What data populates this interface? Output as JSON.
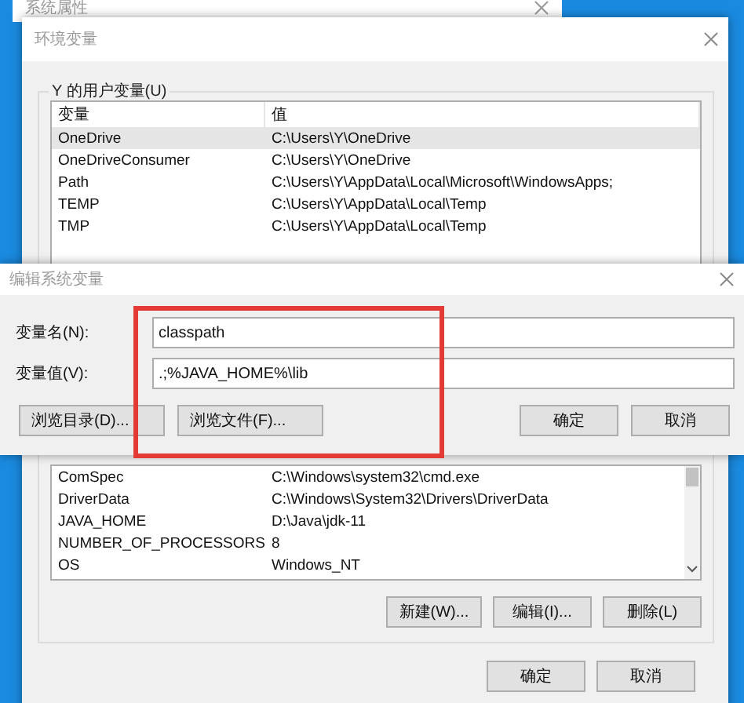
{
  "background_window": {
    "title": "系统属性"
  },
  "env_window": {
    "title": "环境变量",
    "user_vars": {
      "label": "Y 的用户变量(U)",
      "columns": [
        "变量",
        "值"
      ],
      "rows": [
        {
          "name": "OneDrive",
          "value": "C:\\Users\\Y\\OneDrive",
          "selected": true
        },
        {
          "name": "OneDriveConsumer",
          "value": "C:\\Users\\Y\\OneDrive",
          "selected": false
        },
        {
          "name": "Path",
          "value": "C:\\Users\\Y\\AppData\\Local\\Microsoft\\WindowsApps;",
          "selected": false
        },
        {
          "name": "TEMP",
          "value": "C:\\Users\\Y\\AppData\\Local\\Temp",
          "selected": false
        },
        {
          "name": "TMP",
          "value": "C:\\Users\\Y\\AppData\\Local\\Temp",
          "selected": false
        }
      ]
    },
    "system_vars": {
      "rows": [
        {
          "name": "ComSpec",
          "value": "C:\\Windows\\system32\\cmd.exe",
          "selected": false
        },
        {
          "name": "DriverData",
          "value": "C:\\Windows\\System32\\Drivers\\DriverData",
          "selected": false
        },
        {
          "name": "JAVA_HOME",
          "value": "D:\\Java\\jdk-11",
          "selected": false
        },
        {
          "name": "NUMBER_OF_PROCESSORS",
          "value": "8",
          "selected": false
        },
        {
          "name": "OS",
          "value": "Windows_NT",
          "selected": false
        }
      ],
      "buttons": [
        "新建(W)...",
        "编辑(I)...",
        "删除(L)"
      ]
    },
    "buttons": [
      "确定",
      "取消"
    ]
  },
  "edit_dialog": {
    "title": "编辑系统变量",
    "fields": [
      {
        "label": "变量名(N):",
        "value": "classpath"
      },
      {
        "label": "变量值(V):",
        "value": ".;%JAVA_HOME%\\lib"
      }
    ],
    "buttons": [
      {
        "label": "浏览目录(D)...",
        "kind": "browse"
      },
      {
        "label": "浏览文件(F)...",
        "kind": "browse"
      },
      {
        "label": "确定",
        "kind": "dialog"
      },
      {
        "label": "取消",
        "kind": "dialog"
      }
    ]
  }
}
